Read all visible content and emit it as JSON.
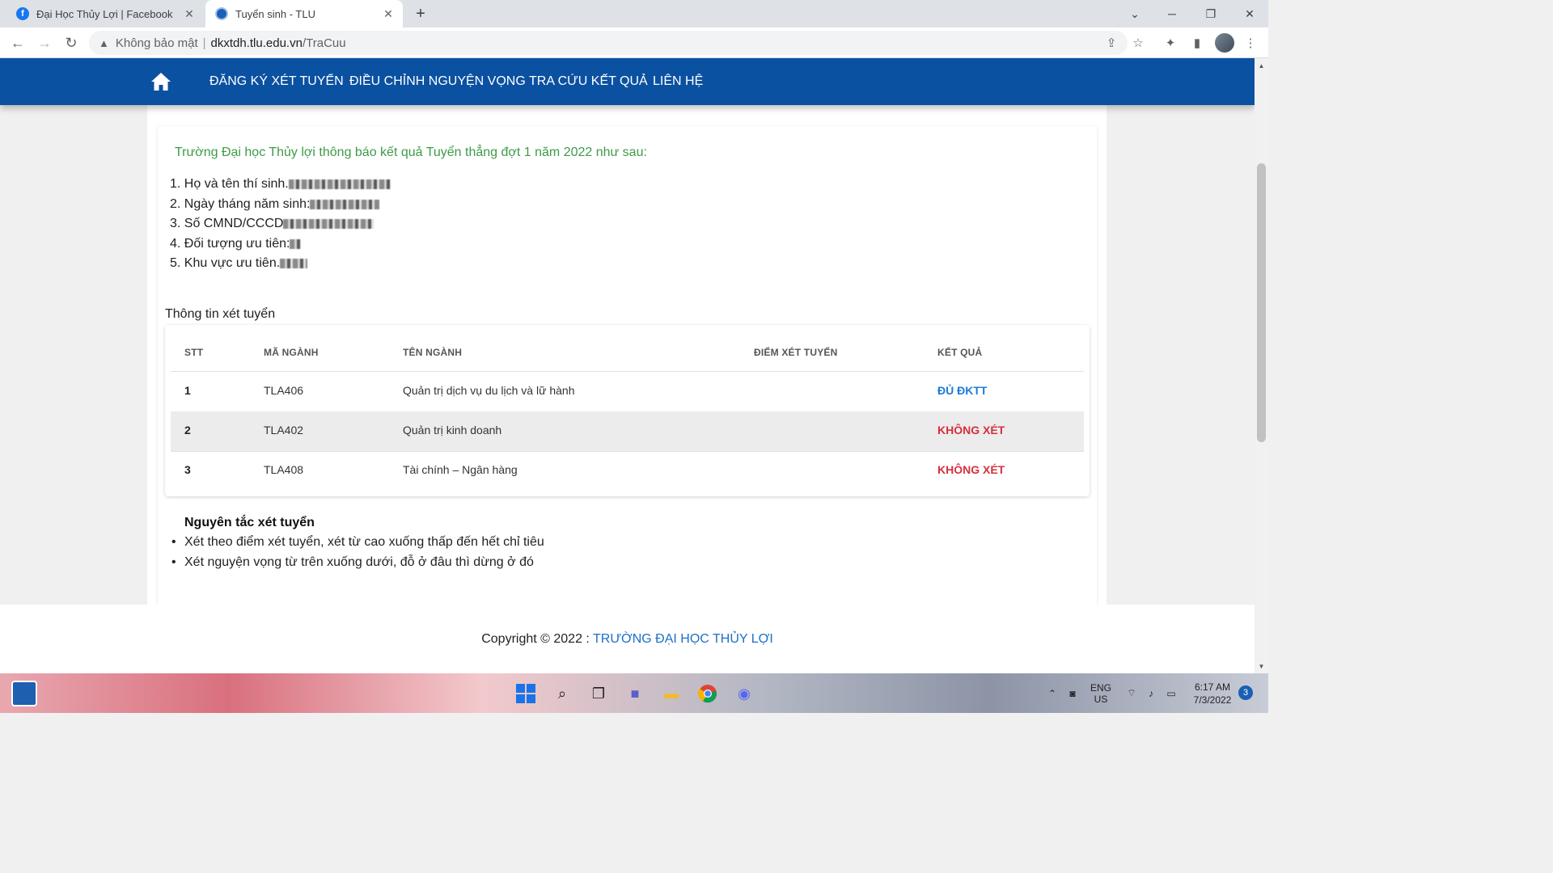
{
  "browser": {
    "tabs": [
      {
        "title": "Đại Học Thủy Lợi | Facebook",
        "favicon": "facebook-icon",
        "active": false
      },
      {
        "title": "Tuyển sinh - TLU",
        "favicon": "tlu-logo-icon",
        "active": true
      }
    ],
    "address": {
      "security_label": "Không bảo mật",
      "host": "dkxtdh.tlu.edu.vn",
      "path": "/TraCuu"
    }
  },
  "nav": {
    "links": [
      "ĐĂNG KÝ XÉT TUYỂN",
      "ĐIỀU CHỈNH NGUYỆN VỌNG",
      "TRA CỨU KẾT QUẢ",
      "LIÊN HỆ"
    ]
  },
  "announcement": "Trường Đại học Thủy lợi thông báo kết quả Tuyển thẳng đợt 1 năm 2022 như sau:",
  "candidate_info": [
    {
      "label": "1. Họ và tên thí sinh."
    },
    {
      "label": "2. Ngày tháng năm sinh: "
    },
    {
      "label": "3. Số CMND/CCCD "
    },
    {
      "label": "4. Đối tượng ưu tiên:"
    },
    {
      "label": "5. Khu vực ưu tiên."
    }
  ],
  "results": {
    "section_title": "Thông tin xét tuyển",
    "headers": [
      "STT",
      "MÃ NGÀNH",
      "TÊN NGÀNH",
      "ĐIỂM XÉT TUYỂN",
      "KẾT QUẢ"
    ],
    "rows": [
      {
        "stt": "1",
        "code": "TLA406",
        "name": "Quản trị dịch vụ du lịch và lữ hành",
        "score": "",
        "result": "ĐỦ ĐKTT"
      },
      {
        "stt": "2",
        "code": "TLA402",
        "name": "Quản trị kinh doanh",
        "score": "",
        "result": "KHÔNG XÉT"
      },
      {
        "stt": "3",
        "code": "TLA408",
        "name": "Tài chính – Ngân hàng",
        "score": "",
        "result": "KHÔNG XÉT"
      }
    ]
  },
  "rules": {
    "title": "Nguyên tắc xét tuyển",
    "items": [
      "Xét theo điểm xét tuyển, xét từ cao xuống thấp đến hết chỉ tiêu",
      "Xét nguyện vọng từ trên xuống dưới, đỗ ở đâu thì dừng ở đó"
    ]
  },
  "footer": {
    "prefix": "Copyright © 2022 : ",
    "link": "TRƯỜNG ĐẠI HỌC THỦY LỢI"
  },
  "taskbar": {
    "lang_top": "ENG",
    "lang_bottom": "US",
    "time": "6:17 AM",
    "date": "7/3/2022",
    "notification_count": "3"
  },
  "colors": {
    "navbar": "#0b51a1",
    "announcement": "#3e9b47",
    "result_ok": "#1e7ad6",
    "result_no": "#d62f3c",
    "footer_link": "#1d6fc4"
  }
}
